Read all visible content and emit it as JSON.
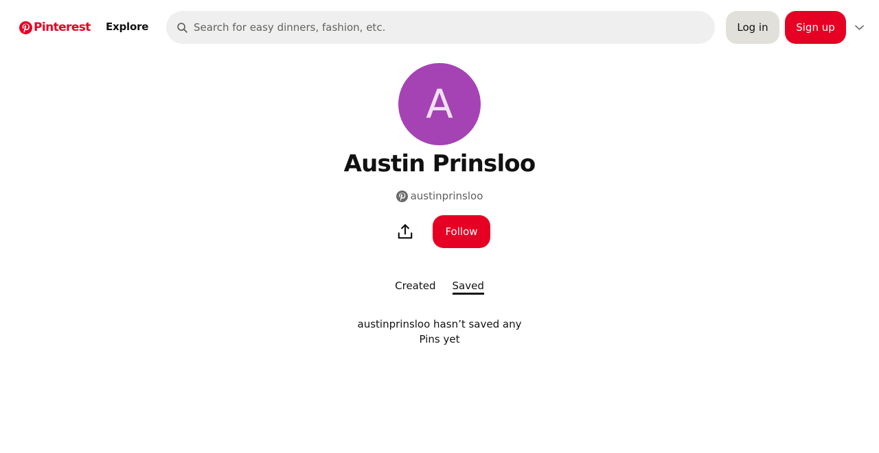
{
  "header": {
    "logo_text": "Pinterest",
    "nav_explore": "Explore",
    "search_placeholder": "Search for easy dinners, fashion, etc.",
    "login_label": "Log in",
    "signup_label": "Sign up"
  },
  "profile": {
    "avatar_initial": "A",
    "avatar_color": "#a543b5",
    "name": "Austin Prinsloo",
    "username": "austinprinsloo",
    "follow_label": "Follow"
  },
  "tabs": [
    {
      "label": "Created",
      "active": false
    },
    {
      "label": "Saved",
      "active": true
    }
  ],
  "empty_state": {
    "message": "austinprinsloo hasn’t saved any Pins yet"
  },
  "colors": {
    "brand": "#e60023",
    "search_bg": "#efefef",
    "secondary_button": "#e2e0da"
  },
  "icons": [
    "pinterest-logo-icon",
    "search-icon",
    "chevron-down-icon",
    "pinterest-badge-icon",
    "share-icon"
  ]
}
